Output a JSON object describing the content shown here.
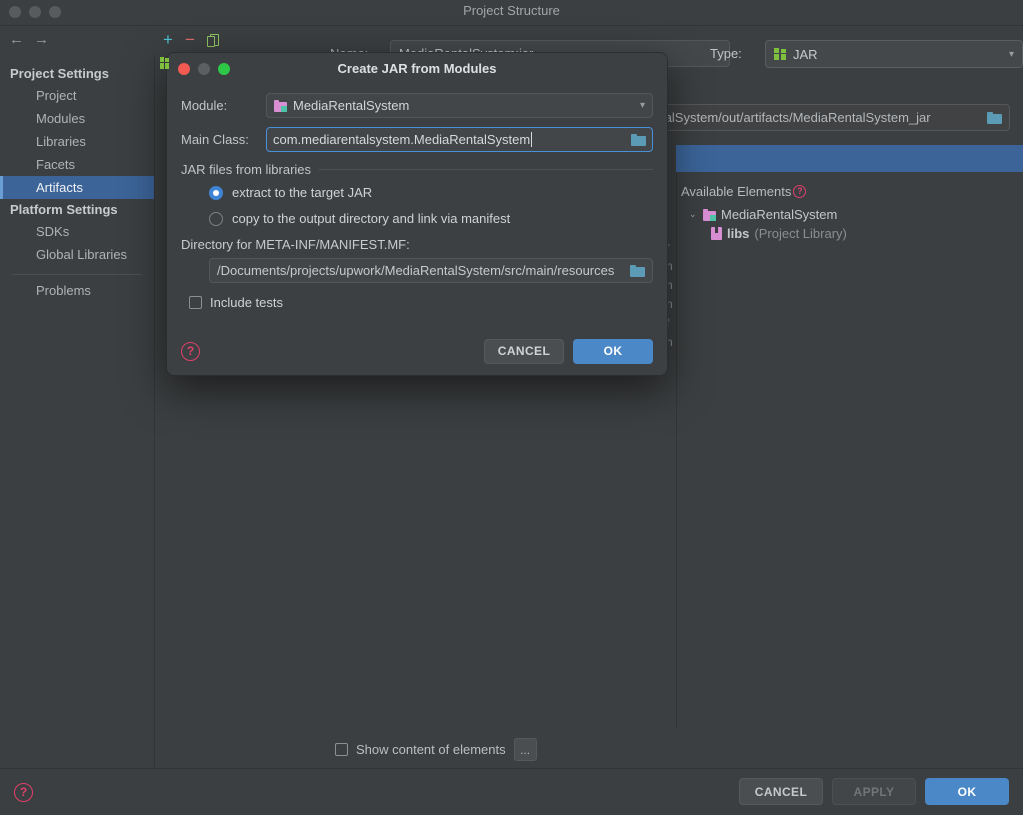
{
  "window": {
    "title": "Project Structure",
    "nav": {
      "back": "←",
      "forward": "→"
    }
  },
  "sidebar": {
    "groups": [
      {
        "label": "Project Settings",
        "items": [
          "Project",
          "Modules",
          "Libraries",
          "Facets",
          "Artifacts"
        ]
      },
      {
        "label": "Platform Settings",
        "items": [
          "SDKs",
          "Global Libraries"
        ]
      }
    ],
    "selected": "Artifacts",
    "extra_items": [
      "Problems"
    ]
  },
  "toolbar": {
    "add": "+",
    "remove": "−",
    "copy_icon": "copy-icon"
  },
  "artifact": {
    "name_label": "Name:",
    "name_value": "MediaRentalSystem:jar",
    "type_label": "Type:",
    "type_value": "JAR",
    "output_directory": "aRentalSystem/out/artifacts/MediaRentalSystem_jar"
  },
  "right_panel": {
    "available_elements_label": "Available Elements",
    "help_glyph": "?",
    "tree": [
      {
        "label": "MediaRentalSystem",
        "icon": "module-icon",
        "twisty": "⌄",
        "level": 0,
        "suffix": ""
      },
      {
        "label": "libs",
        "icon": "library-icon",
        "twisty": "",
        "level": 1,
        "suffix": "(Project Library)"
      }
    ],
    "occluded_fragments": "r\nn\nn\nn\nf\nn"
  },
  "bottom": {
    "show_content_label": "Show content of elements",
    "ellipsis_label": "..."
  },
  "footer": {
    "help_glyph": "?",
    "cancel": "CANCEL",
    "apply": "APPLY",
    "ok": "OK"
  },
  "dialog": {
    "title": "Create JAR from Modules",
    "module_label": "Module:",
    "module_value": "MediaRentalSystem",
    "main_class_label": "Main Class:",
    "main_class_value": "com.mediarentalsystem.MediaRentalSystem",
    "group_label": "JAR files from libraries",
    "radio_extract": "extract to the target JAR",
    "radio_copy": "copy to the output directory and link via manifest",
    "directory_label": "Directory for META-INF/MANIFEST.MF:",
    "directory_value": "/Documents/projects/upwork/MediaRentalSystem/src/main/resources",
    "include_tests_label": "Include tests",
    "help_glyph": "?",
    "cancel": "CANCEL",
    "ok": "OK"
  }
}
